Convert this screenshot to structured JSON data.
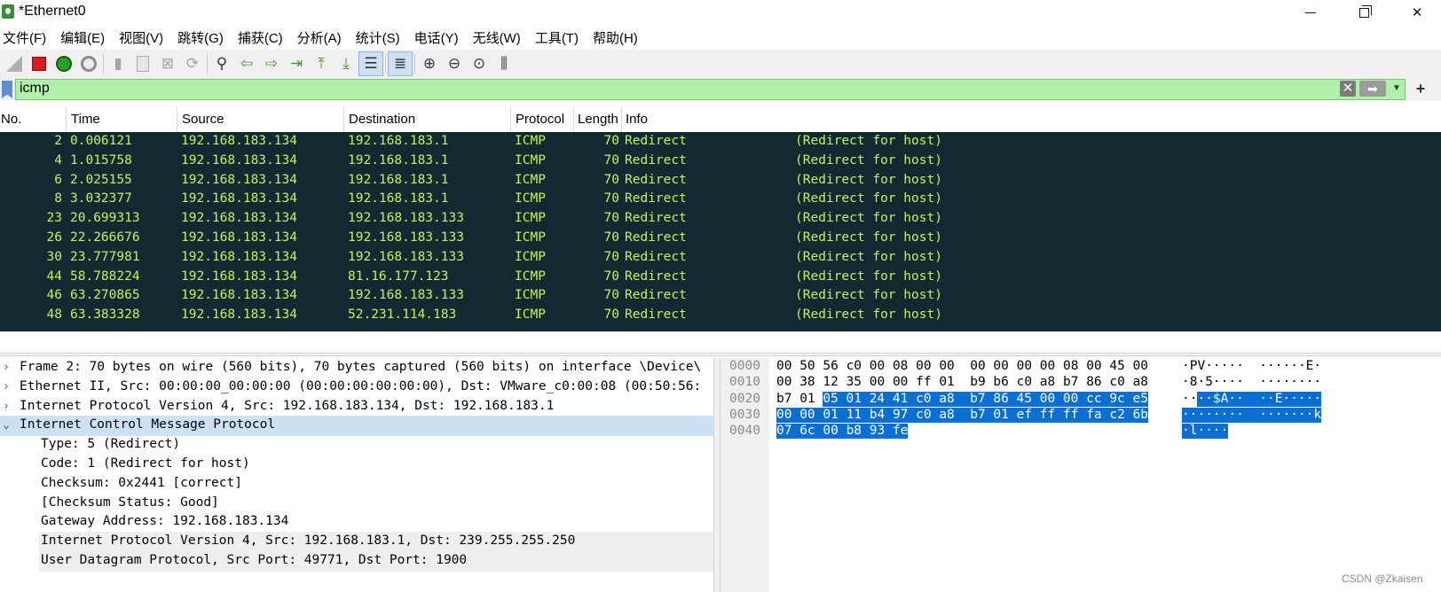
{
  "window": {
    "title": "*Ethernet0",
    "controls": {
      "minimize": "",
      "maximize": "",
      "close": "✕"
    }
  },
  "menu": [
    "文件(F)",
    "编辑(E)",
    "视图(V)",
    "跳转(G)",
    "捕获(C)",
    "分析(A)",
    "统计(S)",
    "电话(Y)",
    "无线(W)",
    "工具(T)",
    "帮助(H)"
  ],
  "toolbar_icons": [
    "shark-fin-icon",
    "stop-capture-icon",
    "restart-capture-icon",
    "capture-options-icon",
    "open-file-icon",
    "save-file-icon",
    "close-file-icon",
    "reload-file-icon",
    "find-packet-icon",
    "go-back-icon",
    "go-forward-icon",
    "go-to-packet-icon",
    "first-packet-icon",
    "last-packet-icon",
    "autoscroll-icon",
    "colorize-icon",
    "zoom-in-icon",
    "zoom-out-icon",
    "normal-size-icon",
    "resize-columns-icon"
  ],
  "filter": {
    "value": "icmp"
  },
  "packet_columns": [
    "No.",
    "Time",
    "Source",
    "Destination",
    "Protocol",
    "Length",
    "Info"
  ],
  "packets": [
    {
      "no": "2",
      "time": "0.006121",
      "source": "192.168.183.134",
      "destination": "192.168.183.1",
      "protocol": "ICMP",
      "length": "70",
      "info": "Redirect              (Redirect for host)"
    },
    {
      "no": "4",
      "time": "1.015758",
      "source": "192.168.183.134",
      "destination": "192.168.183.1",
      "protocol": "ICMP",
      "length": "70",
      "info": "Redirect              (Redirect for host)"
    },
    {
      "no": "6",
      "time": "2.025155",
      "source": "192.168.183.134",
      "destination": "192.168.183.1",
      "protocol": "ICMP",
      "length": "70",
      "info": "Redirect              (Redirect for host)"
    },
    {
      "no": "8",
      "time": "3.032377",
      "source": "192.168.183.134",
      "destination": "192.168.183.1",
      "protocol": "ICMP",
      "length": "70",
      "info": "Redirect              (Redirect for host)"
    },
    {
      "no": "23",
      "time": "20.699313",
      "source": "192.168.183.134",
      "destination": "192.168.183.133",
      "protocol": "ICMP",
      "length": "70",
      "info": "Redirect              (Redirect for host)"
    },
    {
      "no": "26",
      "time": "22.266676",
      "source": "192.168.183.134",
      "destination": "192.168.183.133",
      "protocol": "ICMP",
      "length": "70",
      "info": "Redirect              (Redirect for host)"
    },
    {
      "no": "30",
      "time": "23.777981",
      "source": "192.168.183.134",
      "destination": "192.168.183.133",
      "protocol": "ICMP",
      "length": "70",
      "info": "Redirect              (Redirect for host)"
    },
    {
      "no": "44",
      "time": "58.788224",
      "source": "192.168.183.134",
      "destination": "81.16.177.123",
      "protocol": "ICMP",
      "length": "70",
      "info": "Redirect              (Redirect for host)"
    },
    {
      "no": "46",
      "time": "63.270865",
      "source": "192.168.183.134",
      "destination": "192.168.183.133",
      "protocol": "ICMP",
      "length": "70",
      "info": "Redirect              (Redirect for host)"
    },
    {
      "no": "48",
      "time": "63.383328",
      "source": "192.168.183.134",
      "destination": "52.231.114.183",
      "protocol": "ICMP",
      "length": "70",
      "info": "Redirect              (Redirect for host)"
    }
  ],
  "details": [
    {
      "text": "Frame 2: 70 bytes on wire (560 bits), 70 bytes captured (560 bits) on interface \\Device\\",
      "arrow": "›",
      "indent": 0,
      "state": ""
    },
    {
      "text": "Ethernet II, Src: 00:00:00_00:00:00 (00:00:00:00:00:00), Dst: VMware_c0:00:08 (00:50:56:",
      "arrow": "›",
      "indent": 0,
      "state": ""
    },
    {
      "text": "Internet Protocol Version 4, Src: 192.168.183.134, Dst: 192.168.183.1",
      "arrow": "›",
      "indent": 0,
      "state": ""
    },
    {
      "text": "Internet Control Message Protocol",
      "arrow": "⌄",
      "indent": 0,
      "state": "sel"
    },
    {
      "text": "Type: 5 (Redirect)",
      "arrow": "",
      "indent": 1,
      "state": ""
    },
    {
      "text": "Code: 1 (Redirect for host)",
      "arrow": "",
      "indent": 1,
      "state": ""
    },
    {
      "text": "Checksum: 0x2441 [correct]",
      "arrow": "",
      "indent": 1,
      "state": ""
    },
    {
      "text": "[Checksum Status: Good]",
      "arrow": "",
      "indent": 1,
      "state": ""
    },
    {
      "text": "Gateway Address: 192.168.183.134",
      "arrow": "",
      "indent": 1,
      "state": ""
    },
    {
      "text": "Internet Protocol Version 4, Src: 192.168.183.1, Dst: 239.255.255.250",
      "arrow": "›",
      "indent": 1,
      "state": "sub"
    },
    {
      "text": "User Datagram Protocol, Src Port: 49771, Dst Port: 1900",
      "arrow": "›",
      "indent": 1,
      "state": "sub"
    }
  ],
  "hex_rows": [
    {
      "offset": "0000",
      "bytes_plain": "00 50 56 c0 00 08 00 00  00 00 00 00 08 00 45 00",
      "bytes_hl": "",
      "ascii_plain": "·PV·····  ······E·",
      "ascii_hl": ""
    },
    {
      "offset": "0010",
      "bytes_plain": "00 38 12 35 00 00 ff 01  b9 b6 c0 a8 b7 86 c0 a8",
      "bytes_hl": "",
      "ascii_plain": "·8·5····  ········",
      "ascii_hl": ""
    },
    {
      "offset": "0020",
      "bytes_plain": "b7 01 ",
      "bytes_hl": "05 01 24 41 c0 a8  b7 86 45 00 00 cc 9c e5",
      "ascii_plain": "··",
      "ascii_hl": "··$A··  ··E·····"
    },
    {
      "offset": "0030",
      "bytes_plain": "",
      "bytes_hl": "00 00 01 11 b4 97 c0 a8  b7 01 ef ff ff fa c2 6b",
      "ascii_plain": "",
      "ascii_hl": "········  ·······k"
    },
    {
      "offset": "0040",
      "bytes_plain": "",
      "bytes_hl": "07 6c 00 b8 93 fe",
      "ascii_plain": "",
      "ascii_hl": "·l····"
    }
  ],
  "watermark": "CSDN @Zkaisen",
  "colors": {
    "row_bg": "#132932",
    "row_fg": "#c3f25b",
    "filter_bg": "#aff1a8",
    "selection": "#cce1f3",
    "hex_highlight": "#0a6fd2"
  }
}
